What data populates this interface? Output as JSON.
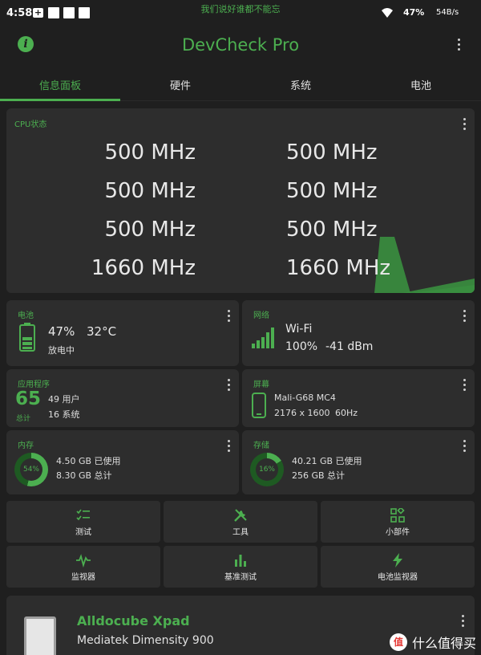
{
  "status_bar": {
    "time": "4:58",
    "plus_icon": "+",
    "center_text": "我们说好谁都不能忘",
    "battery": "47%",
    "net_speed": "54B/s"
  },
  "app_bar": {
    "title": "DevCheck Pro",
    "info_icon": "i"
  },
  "tabs": [
    {
      "label": "信息面板",
      "active": true
    },
    {
      "label": "硬件",
      "active": false
    },
    {
      "label": "系统",
      "active": false
    },
    {
      "label": "电池",
      "active": false
    }
  ],
  "cpu": {
    "title": "CPU状态",
    "freqs": [
      "500 MHz",
      "500 MHz",
      "500 MHz",
      "500 MHz",
      "500 MHz",
      "500 MHz",
      "1660 MHz",
      "1660 MHz"
    ]
  },
  "battery_card": {
    "title": "电池",
    "percent": "47%",
    "temp": "32°C",
    "status": "放电中"
  },
  "network_card": {
    "title": "网络",
    "type": "Wi-Fi",
    "signal": "100%",
    "dbm": "-41 dBm"
  },
  "apps_card": {
    "title": "应用程序",
    "total": "65",
    "total_label": "总计",
    "user": "49 用户",
    "system": "16 系统"
  },
  "screen_card": {
    "title": "屏幕",
    "gpu": "Mali-G68 MC4",
    "resolution": "2176 x 1600",
    "refresh": "60Hz"
  },
  "memory_card": {
    "title": "内存",
    "percent": "54%",
    "fraction": 0.54,
    "used": "4.50 GB 已使用",
    "total": "8.30 GB 总计"
  },
  "storage_card": {
    "title": "存储",
    "percent": "16%",
    "fraction": 0.16,
    "used": "40.21 GB 已使用",
    "total": "256 GB 总计"
  },
  "buttons": [
    {
      "label": "测试",
      "icon": "checklist-icon"
    },
    {
      "label": "工具",
      "icon": "tools-icon"
    },
    {
      "label": "小部件",
      "icon": "widgets-icon"
    },
    {
      "label": "监视器",
      "icon": "pulse-icon"
    },
    {
      "label": "基准测试",
      "icon": "bar-chart-icon"
    },
    {
      "label": "电池监视器",
      "icon": "bolt-icon"
    }
  ],
  "device": {
    "name": "Alldocube Xpad",
    "chip": "Mediatek Dimensity 900"
  },
  "watermark": {
    "logo": "值",
    "text": "什么值得买"
  },
  "colors": {
    "accent": "#4caf50",
    "background": "#1f1f1f",
    "card": "#2d2d2d"
  }
}
